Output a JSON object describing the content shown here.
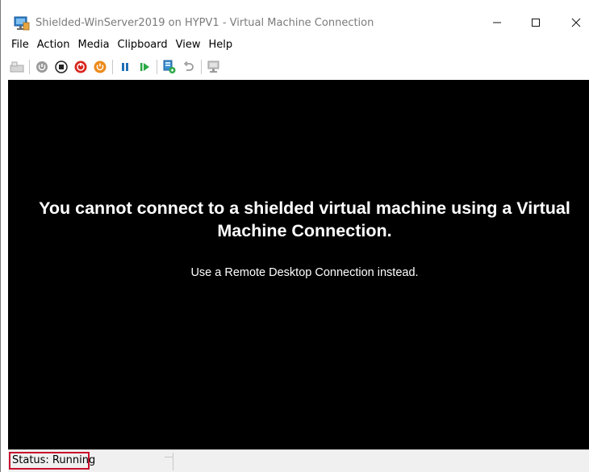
{
  "window": {
    "title": "Shielded-WinServer2019 on HYPV1 - Virtual Machine Connection",
    "controls": {
      "minimize_icon": "minimize-icon",
      "maximize_icon": "maximize-icon",
      "close_icon": "close-icon"
    }
  },
  "menu": {
    "items": [
      "File",
      "Action",
      "Media",
      "Clipboard",
      "View",
      "Help"
    ]
  },
  "toolbar": {
    "buttons": [
      "ctrl-alt-del-icon",
      "start-icon",
      "turn-off-icon",
      "shut-down-icon",
      "save-state-icon",
      "pause-icon",
      "resume-icon",
      "checkpoint-icon",
      "revert-icon",
      "enhanced-session-icon"
    ]
  },
  "console": {
    "message": "You cannot connect to a shielded virtual machine using a Virtual Machine Connection.",
    "hint": "Use a Remote Desktop Connection instead."
  },
  "status": {
    "text": "Status: Running",
    "highlight_color": "#c8102e"
  }
}
